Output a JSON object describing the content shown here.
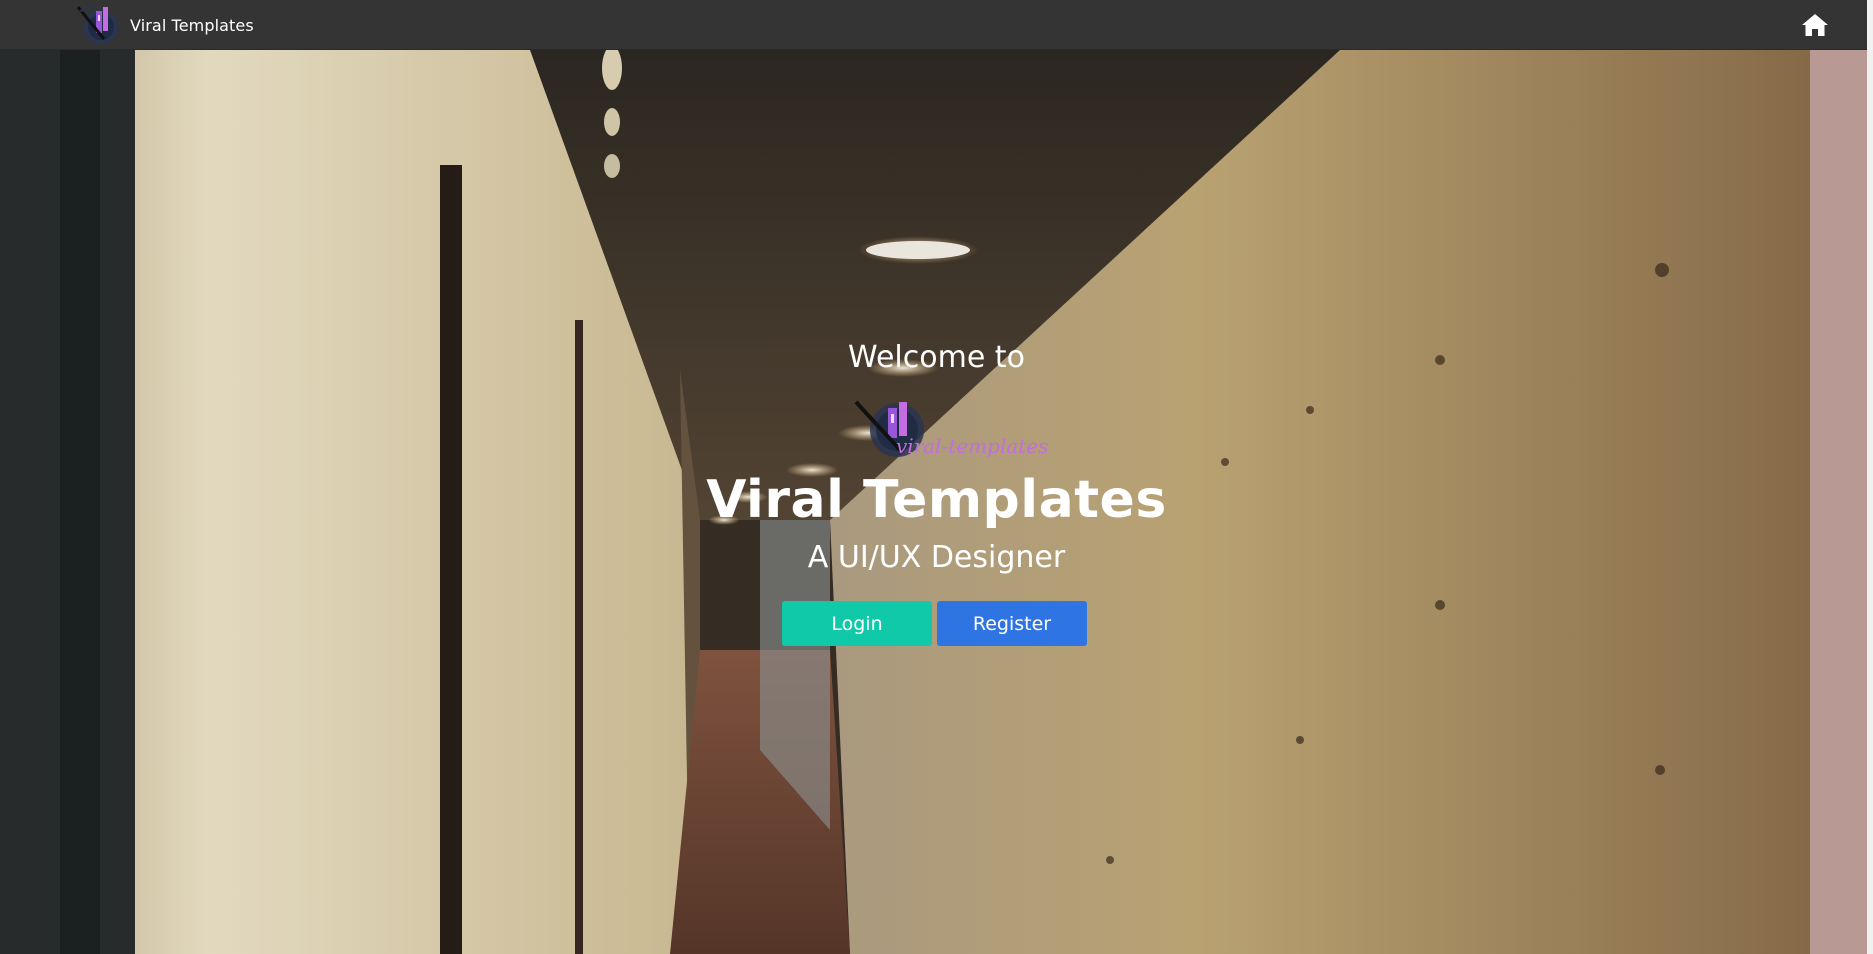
{
  "navbar": {
    "brand_name": "Viral Templates",
    "home_icon": "home-icon"
  },
  "hero": {
    "welcome": "Welcome to",
    "logo_text": "viral-templates",
    "title": "Viral Templates",
    "subtitle": "A UI/UX Designer",
    "login_label": "Login",
    "register_label": "Register"
  },
  "colors": {
    "navbar_bg": "#343434",
    "login_button": "#10c9a9",
    "register_button": "#2f74e3",
    "logo_text": "#c46de0"
  }
}
